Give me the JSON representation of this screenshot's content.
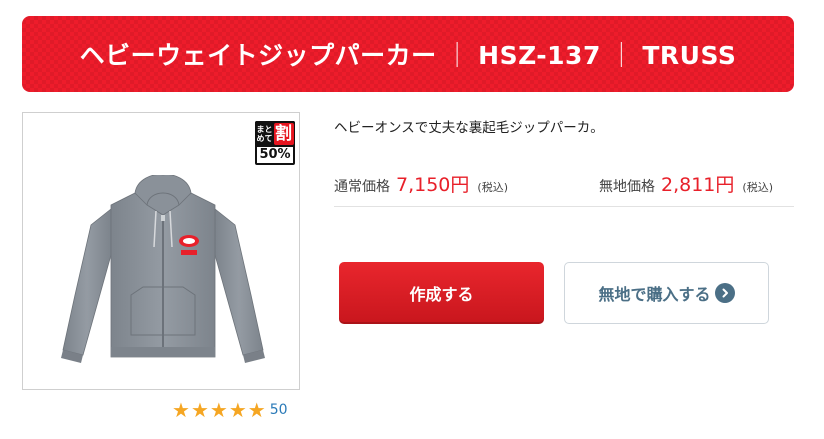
{
  "banner": {
    "product_name": "ヘビーウェイトジップパーカー",
    "separator": "｜",
    "model": "HSZ-137",
    "brand": "TRUSS",
    "background_color": "#ee1c2b"
  },
  "badge": {
    "line1": "まと",
    "line2": "めて",
    "big_char": "割",
    "discount": "50%"
  },
  "product_image": {
    "icon": "gray-zip-hoodie-image",
    "color": "#8e959d"
  },
  "rating": {
    "stars": 5,
    "max_stars": 5,
    "count": "50",
    "star_color": "#f5a623"
  },
  "description": "ヘビーオンスで丈夫な裏起毛ジップパーカ。",
  "prices": {
    "regular": {
      "label": "通常価格",
      "value": "7,150円",
      "tax": "(税込)"
    },
    "plain": {
      "label": "無地価格",
      "value": "2,811円",
      "tax": "(税込)"
    },
    "accent_color": "#e8202a"
  },
  "buttons": {
    "create": "作成する",
    "buy_plain": "無地で購入する"
  }
}
